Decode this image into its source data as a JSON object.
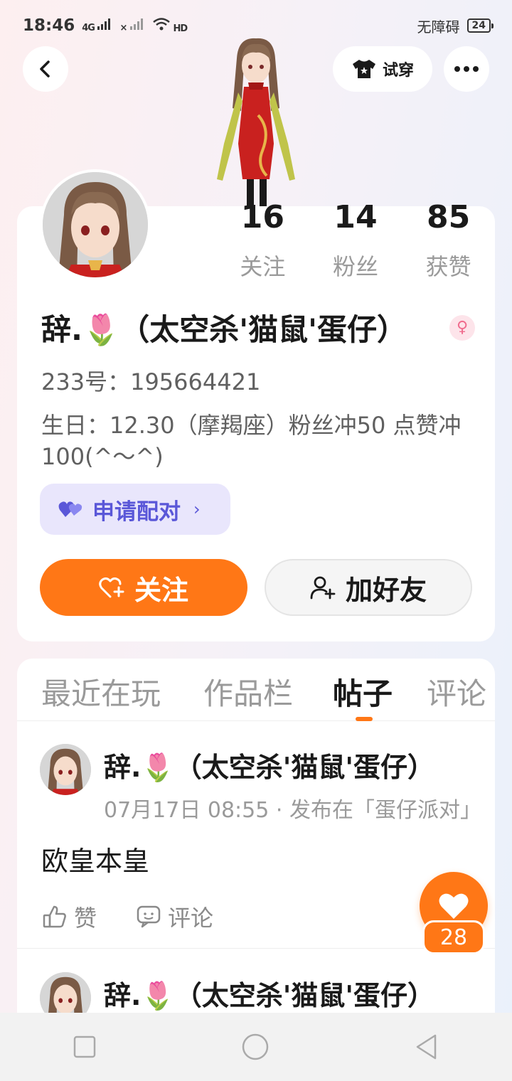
{
  "status_bar": {
    "time": "18:46",
    "signal1": "4G",
    "signal2": "×",
    "wifi": "HD",
    "a11y_label": "无障碍",
    "battery": "24"
  },
  "header": {
    "tryon_label": "试穿"
  },
  "profile": {
    "stats": [
      {
        "value": "16",
        "label": "关注"
      },
      {
        "value": "14",
        "label": "粉丝"
      },
      {
        "value": "85",
        "label": "获赞"
      }
    ],
    "name": "辞.🌷（太空杀'猫鼠'蛋仔）",
    "gender_symbol": "♀",
    "id_line": "233号：195664421",
    "bio": "生日：12.30（摩羯座）粉丝冲50 点赞冲100(^～^)",
    "pair_label": "申请配对",
    "pair_chevron": "›",
    "follow_label": "关注",
    "add_friend_label": "加好友"
  },
  "tabs": [
    "最近在玩",
    "作品栏",
    "帖子",
    "评论"
  ],
  "posts": [
    {
      "author": "辞.🌷（太空杀'猫鼠'蛋仔）",
      "meta": "07月17日 08:55 · 发布在「蛋仔派对」",
      "content": "欧皇本皇",
      "like_label": "赞",
      "comment_label": "评论"
    },
    {
      "author": "辞.🌷（太空杀'猫鼠'蛋仔）"
    }
  ],
  "floating_like": {
    "count": "28"
  },
  "colors": {
    "accent": "#ff7716",
    "pair": "#5a57d8",
    "female": "#f06c8e"
  }
}
